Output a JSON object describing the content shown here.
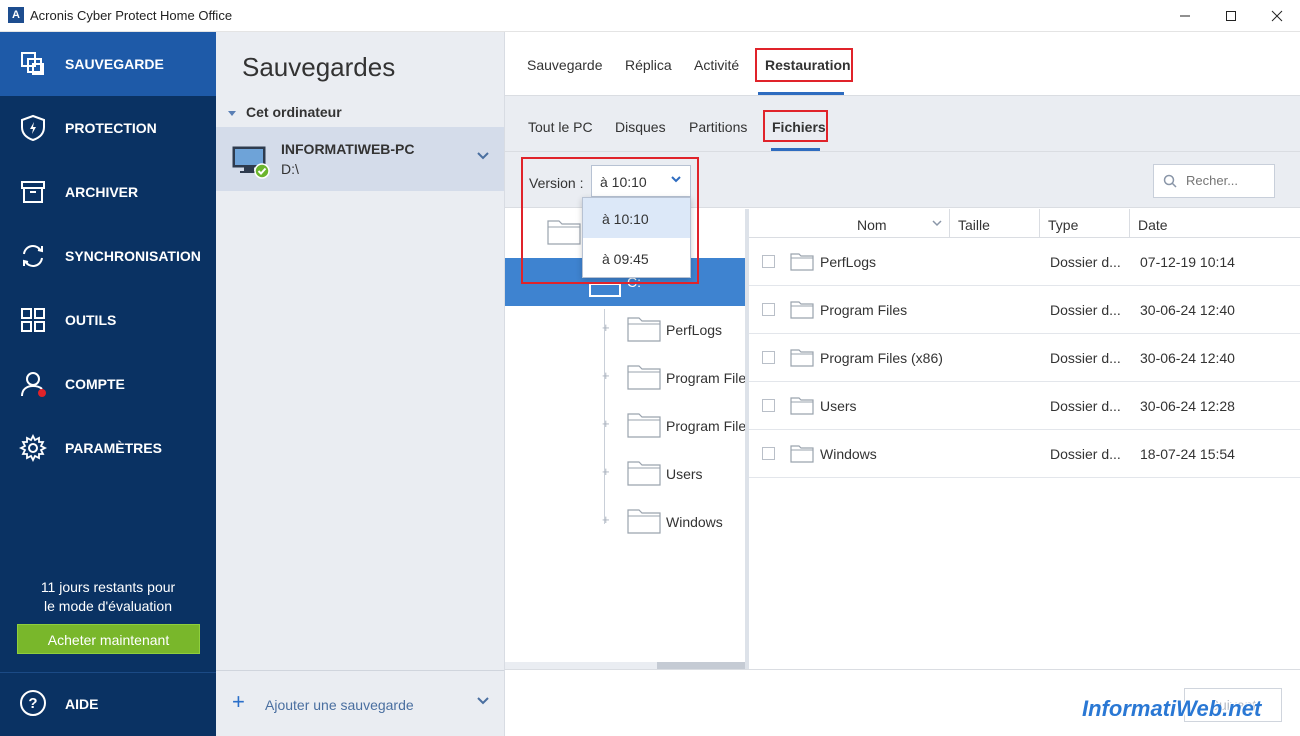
{
  "window": {
    "title": "Acronis Cyber Protect Home Office",
    "app_icon_letter": "A"
  },
  "nav": {
    "items": [
      {
        "label": "SAUVEGARDE",
        "icon": "backup-copy-icon",
        "active": true
      },
      {
        "label": "PROTECTION",
        "icon": "shield-bolt-icon",
        "active": false
      },
      {
        "label": "ARCHIVER",
        "icon": "archive-box-icon",
        "active": false
      },
      {
        "label": "SYNCHRONISATION",
        "icon": "sync-arrows-icon",
        "active": false
      },
      {
        "label": "OUTILS",
        "icon": "grid-tools-icon",
        "active": false
      },
      {
        "label": "COMPTE",
        "icon": "user-account-icon",
        "active": false
      },
      {
        "label": "PARAMÈTRES",
        "icon": "gear-icon",
        "active": false
      }
    ],
    "trial_line1": "11 jours restants pour",
    "trial_line2": "le mode d'évaluation",
    "buy_label": "Acheter maintenant",
    "help_label": "AIDE",
    "colors": {
      "bg": "#0a3263",
      "active": "#1e5aa8",
      "buy": "#79b72b"
    }
  },
  "backups": {
    "heading": "Sauvegardes",
    "group_label": "Cet ordinateur",
    "item": {
      "name": "INFORMATIWEB-PC",
      "drive": "D:\\"
    },
    "add_label": "Ajouter une sauvegarde"
  },
  "content": {
    "top_tabs": [
      "Sauvegarde",
      "Réplica",
      "Activité",
      "Restauration"
    ],
    "active_top_tab": "Restauration",
    "sub_tabs": [
      "Tout le PC",
      "Disques",
      "Partitions",
      "Fichiers"
    ],
    "active_sub_tab": "Fichiers",
    "version_label": "Version :",
    "version_value": "à 10:10",
    "version_options": [
      "à 10:10",
      "à 09:45"
    ],
    "search_placeholder": "Recher...",
    "tree_drive_partial": "C:",
    "tree_children": [
      "PerfLogs",
      "Program Files",
      "Program Files",
      "Users",
      "Windows"
    ],
    "columns": [
      "Nom",
      "Taille",
      "Type",
      "Date"
    ],
    "rows": [
      {
        "name": "PerfLogs",
        "type": "Dossier d...",
        "date": "07-12-19 10:14"
      },
      {
        "name": "Program Files",
        "type": "Dossier d...",
        "date": "30-06-24 12:40"
      },
      {
        "name": "Program Files (x86)",
        "type": "Dossier d...",
        "date": "30-06-24 12:40"
      },
      {
        "name": "Users",
        "type": "Dossier d...",
        "date": "30-06-24 12:28"
      },
      {
        "name": "Windows",
        "type": "Dossier d...",
        "date": "18-07-24 15:54"
      }
    ],
    "next_label": "Suivant"
  },
  "watermark": "InformatiWeb.net",
  "colors": {
    "accent": "#2e6cc0",
    "highlight": "#e0232a",
    "tree_selected": "#3e83d0"
  }
}
